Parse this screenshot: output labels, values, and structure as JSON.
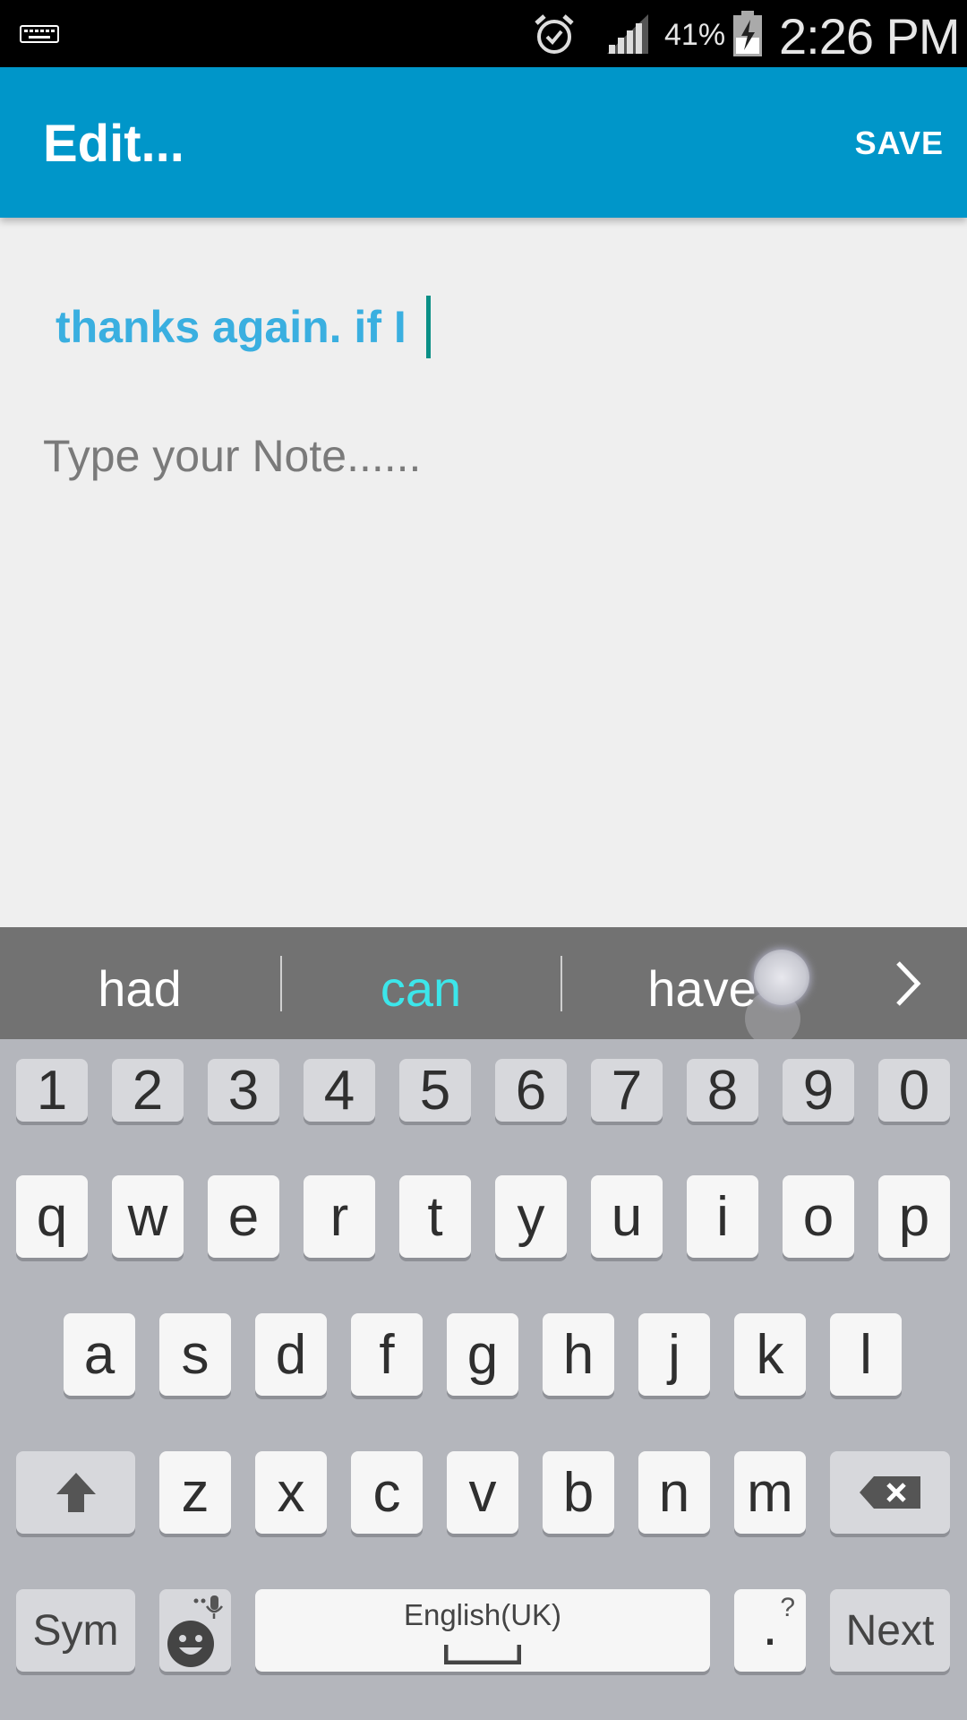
{
  "status_bar": {
    "battery_percent": "41%",
    "time": "2:26 PM",
    "icons": [
      "keyboard-icon",
      "alarm-icon",
      "signal-icon",
      "battery-charging-icon"
    ]
  },
  "app_bar": {
    "title": "Edit...",
    "save_label": "SAVE",
    "color": "#0096c9"
  },
  "editor": {
    "title_value": "thanks again. if I",
    "note_placeholder": "Type your Note......"
  },
  "suggestions": {
    "items": [
      "had",
      "can",
      "have"
    ],
    "highlighted": "can",
    "next_icon": "chevron-right-icon"
  },
  "keyboard": {
    "number_row": [
      "1",
      "2",
      "3",
      "4",
      "5",
      "6",
      "7",
      "8",
      "9",
      "0"
    ],
    "row1": [
      "q",
      "w",
      "e",
      "r",
      "t",
      "y",
      "u",
      "i",
      "o",
      "p"
    ],
    "row2": [
      "a",
      "s",
      "d",
      "f",
      "g",
      "h",
      "j",
      "k",
      "l"
    ],
    "row3": [
      "z",
      "x",
      "c",
      "v",
      "b",
      "n",
      "m"
    ],
    "sym_label": "Sym",
    "space_label": "English(UK)",
    "period_label": ".",
    "period_secondary": "?",
    "next_label": "Next"
  }
}
